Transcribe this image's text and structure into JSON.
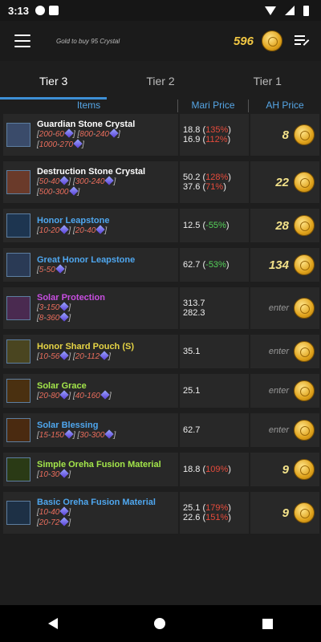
{
  "status": {
    "time": "3:13"
  },
  "header": {
    "subtitle": "Gold to buy 95 Crystal",
    "gold": "596"
  },
  "tabs": [
    {
      "label": "Tier 3"
    },
    {
      "label": "Tier 2"
    },
    {
      "label": "Tier 1"
    }
  ],
  "columns": {
    "items": "Items",
    "mari": "Mari Price",
    "ah": "AH Price"
  },
  "items": [
    {
      "name": "Guardian Stone Crystal",
      "color": "white",
      "thumb": "#3a4b6a",
      "bundles": [
        [
          "200",
          "60"
        ],
        [
          "800",
          "240"
        ],
        [
          "1000",
          "270"
        ]
      ],
      "prices": [
        {
          "value": "18.8",
          "pct": "135%",
          "dir": "red"
        },
        {
          "value": "16.9",
          "pct": "112%",
          "dir": "red"
        }
      ],
      "ah": "8"
    },
    {
      "name": "Destruction Stone Crystal",
      "color": "white",
      "thumb": "#6a3a2a",
      "bundles": [
        [
          "50",
          "40"
        ],
        [
          "300",
          "240"
        ],
        [
          "500",
          "300"
        ]
      ],
      "prices": [
        {
          "value": "50.2",
          "pct": "128%",
          "dir": "red"
        },
        {
          "value": "37.6",
          "pct": "71%",
          "dir": "red"
        }
      ],
      "ah": "22"
    },
    {
      "name": "Honor Leapstone",
      "color": "blue",
      "thumb": "#1d3550",
      "bundles": [
        [
          "10",
          "20"
        ],
        [
          "20",
          "40"
        ]
      ],
      "prices": [
        {
          "value": "12.5",
          "pct": "-55%",
          "dir": "green"
        }
      ],
      "ah": "28"
    },
    {
      "name": "Great Honor Leapstone",
      "color": "blue",
      "thumb": "#2a3a55",
      "bundles": [
        [
          "5",
          "50"
        ]
      ],
      "prices": [
        {
          "value": "62.7",
          "pct": "-53%",
          "dir": "green"
        }
      ],
      "ah": "134"
    },
    {
      "name": "Solar Protection",
      "color": "purple",
      "thumb": "#4a2a50",
      "bundles": [
        [
          "3",
          "150"
        ],
        [
          "8",
          "360"
        ]
      ],
      "prices": [
        {
          "value": "313.7",
          "pct": "",
          "dir": ""
        },
        {
          "value": "282.3",
          "pct": "",
          "dir": ""
        }
      ],
      "ah": "enter"
    },
    {
      "name": "Honor Shard Pouch (S)",
      "color": "yellow",
      "thumb": "#4a4520",
      "bundles": [
        [
          "10",
          "56"
        ],
        [
          "20",
          "112"
        ]
      ],
      "prices": [
        {
          "value": "35.1",
          "pct": "",
          "dir": ""
        }
      ],
      "ah": "enter"
    },
    {
      "name": "Solar Grace",
      "color": "green",
      "thumb": "#4a3010",
      "bundles": [
        [
          "20",
          "80"
        ],
        [
          "40",
          "160"
        ]
      ],
      "prices": [
        {
          "value": "25.1",
          "pct": "",
          "dir": ""
        }
      ],
      "ah": "enter"
    },
    {
      "name": "Solar Blessing",
      "color": "blue",
      "thumb": "#4a2a10",
      "bundles": [
        [
          "15",
          "150"
        ],
        [
          "30",
          "300"
        ]
      ],
      "prices": [
        {
          "value": "62.7",
          "pct": "",
          "dir": ""
        }
      ],
      "ah": "enter"
    },
    {
      "name": "Simple Oreha Fusion Material",
      "color": "green",
      "thumb": "#2a3a15",
      "bundles": [
        [
          "10",
          "30"
        ]
      ],
      "prices": [
        {
          "value": "18.8",
          "pct": "109%",
          "dir": "red"
        }
      ],
      "ah": "9"
    },
    {
      "name": "Basic Oreha Fusion Material",
      "color": "blue",
      "thumb": "#1d3045",
      "bundles": [
        [
          "10",
          "40"
        ],
        [
          "20",
          "72"
        ]
      ],
      "prices": [
        {
          "value": "25.1",
          "pct": "179%",
          "dir": "red"
        },
        {
          "value": "22.6",
          "pct": "151%",
          "dir": "red"
        }
      ],
      "ah": "9"
    }
  ]
}
